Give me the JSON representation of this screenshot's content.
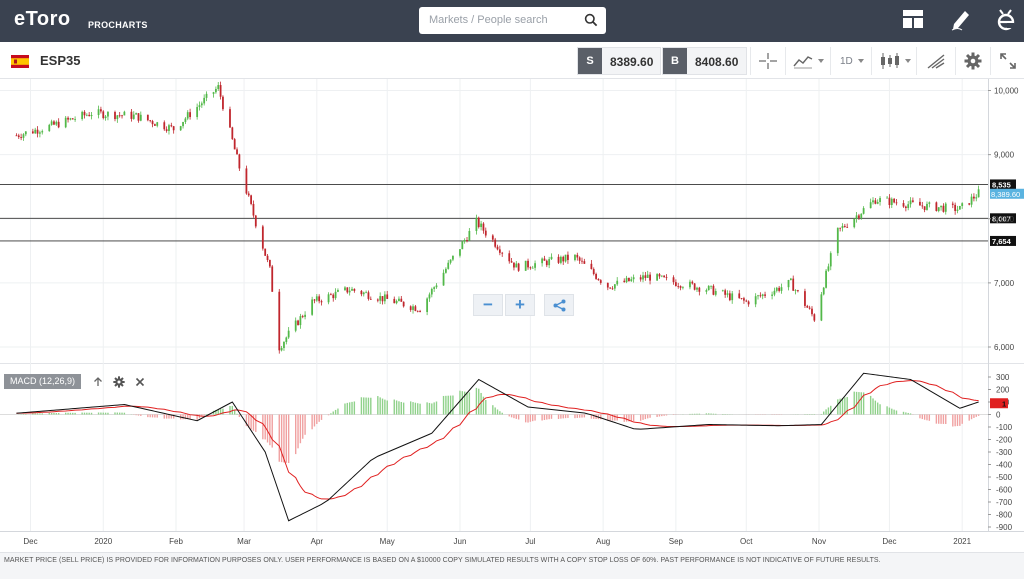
{
  "header": {
    "logo": "eToro",
    "product": "PROCHARTS",
    "search_placeholder": "Markets / People search",
    "icons": [
      "search-icon",
      "layout-icon",
      "pencil-icon",
      "etoro-e-icon"
    ]
  },
  "toolbar": {
    "instrument": "ESP35",
    "sell_tag": "S",
    "sell_price": "8389.60",
    "buy_tag": "B",
    "buy_price": "8408.60",
    "timeframe": "1D",
    "icons": [
      "crosshair-icon",
      "chart-type-icon",
      "candles-icon",
      "drawing-icon",
      "settings-icon",
      "fullscreen-icon"
    ]
  },
  "macd": {
    "label": "MACD (12,26,9)",
    "icons": [
      "arrow-up-icon",
      "gear-icon",
      "close-icon"
    ]
  },
  "zoom": {
    "minus": "−",
    "plus": "+",
    "share_icon": "share-icon"
  },
  "price_axis": {
    "ticks": [
      "10,000",
      "9,000",
      "8,000",
      "7,000",
      "6,000"
    ],
    "levels": [
      {
        "label": "8,535",
        "value": 8535
      },
      {
        "label": "8,007",
        "value": 8007
      },
      {
        "label": "7,654",
        "value": 7654
      }
    ],
    "current_label": "8,389.60",
    "current_color": "#5ab3e0"
  },
  "macd_axis": {
    "ticks": [
      "300",
      "200",
      "100",
      "0",
      "-100",
      "-200",
      "-300",
      "-400",
      "-500",
      "-600",
      "-700",
      "-800",
      "-900"
    ],
    "current_label": "1",
    "current_color": "#e02020"
  },
  "time_axis": {
    "labels": [
      "Dec",
      "2020",
      "Feb",
      "Mar",
      "Apr",
      "May",
      "Jun",
      "Jul",
      "Aug",
      "Sep",
      "Oct",
      "Nov",
      "Dec",
      "2021"
    ]
  },
  "colors": {
    "up": "#52b849",
    "down": "#c0262d",
    "signal": "#e02020",
    "macd": "#111111",
    "header_bg": "#3a4250"
  },
  "chart_data": {
    "type": "candlestick",
    "price_trend": [
      [
        "2019-11-25",
        9300
      ],
      [
        "2019-12-10",
        9450
      ],
      [
        "2019-12-27",
        9650
      ],
      [
        "2020-01-15",
        9600
      ],
      [
        "2020-01-31",
        9400
      ],
      [
        "2020-02-19",
        10050
      ],
      [
        "2020-02-28",
        8800
      ],
      [
        "2020-03-12",
        7200
      ],
      [
        "2020-03-16",
        6000
      ],
      [
        "2020-03-30",
        6700
      ],
      [
        "2020-04-15",
        6900
      ],
      [
        "2020-05-15",
        6600
      ],
      [
        "2020-06-08",
        7950
      ],
      [
        "2020-06-25",
        7250
      ],
      [
        "2020-07-20",
        7400
      ],
      [
        "2020-08-03",
        6950
      ],
      [
        "2020-08-20",
        7100
      ],
      [
        "2020-09-15",
        6900
      ],
      [
        "2020-10-01",
        6700
      ],
      [
        "2020-10-20",
        7000
      ],
      [
        "2020-10-30",
        6450
      ],
      [
        "2020-11-09",
        7800
      ],
      [
        "2020-11-25",
        8300
      ],
      [
        "2020-12-15",
        8200
      ],
      [
        "2020-12-31",
        8150
      ],
      [
        "2021-01-08",
        8400
      ]
    ],
    "macd_trend": [
      [
        "2019-11-25",
        10
      ],
      [
        "2020-01-10",
        80
      ],
      [
        "2020-02-10",
        -50
      ],
      [
        "2020-02-25",
        100
      ],
      [
        "2020-03-10",
        -300
      ],
      [
        "2020-03-20",
        -850
      ],
      [
        "2020-04-05",
        -700
      ],
      [
        "2020-04-25",
        -350
      ],
      [
        "2020-05-20",
        -150
      ],
      [
        "2020-06-09",
        280
      ],
      [
        "2020-06-30",
        60
      ],
      [
        "2020-07-25",
        10
      ],
      [
        "2020-08-15",
        -120
      ],
      [
        "2020-09-15",
        -80
      ],
      [
        "2020-10-15",
        -90
      ],
      [
        "2020-11-02",
        -80
      ],
      [
        "2020-11-20",
        330
      ],
      [
        "2020-12-10",
        280
      ],
      [
        "2020-12-31",
        50
      ],
      [
        "2021-01-08",
        100
      ]
    ],
    "price_range": [
      5800,
      10200
    ],
    "macd_range": [
      -950,
      330
    ]
  }
}
